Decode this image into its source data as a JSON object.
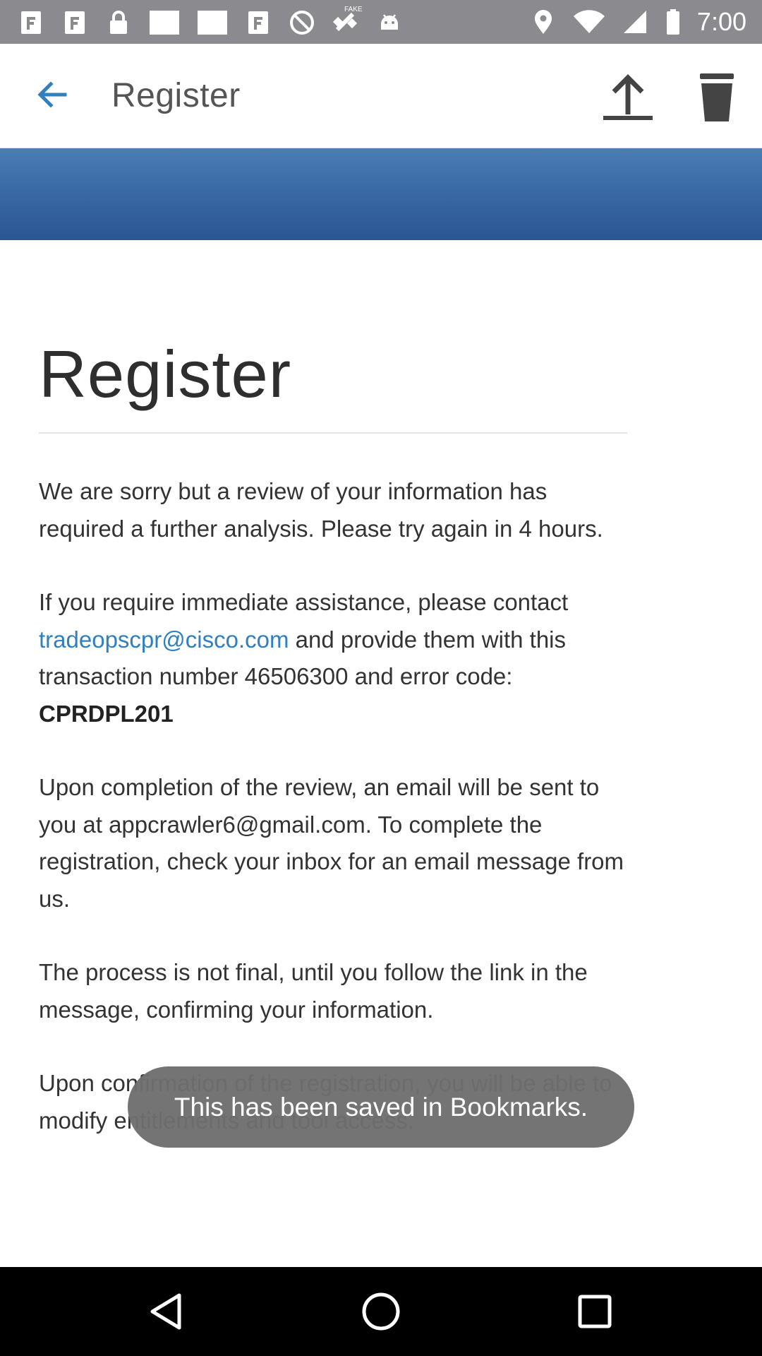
{
  "status_bar": {
    "time": "7:00",
    "fake_gps_label": "FAKE",
    "left_icons": [
      "f-icon",
      "f-icon",
      "lock-icon",
      "blank-notification-icon",
      "blank-notification-icon",
      "f-icon",
      "no-sim-icon",
      "satellite-icon",
      "android-icon"
    ],
    "right_icons": [
      "location-icon",
      "wifi-icon",
      "signal-icon",
      "battery-icon"
    ]
  },
  "app_bar": {
    "title": "Register",
    "back_icon": "arrow-back-icon",
    "upload_icon": "upload-icon",
    "delete_icon": "trash-icon",
    "accent_color": "#2f7fc1"
  },
  "banner": {
    "color": "#3a6aa6"
  },
  "content": {
    "heading": "Register",
    "p1": "We are sorry but a review of your information has required a further analysis. Please try again in 4 hours.",
    "p2_before": "If you require immediate assistance, please contact ",
    "p2_email": "tradeopscpr@cisco.com",
    "p2_middle": " and provide them with this transaction number 46506300 and error code: ",
    "p2_code": "CPRDPL201",
    "p3": "Upon completion of the review, an email will be sent to you at appcrawler6@gmail.com. To complete the registration, check your inbox for an email message from us.",
    "p4": "The process is not final, until you follow the link in the message, confirming your information.",
    "p5": "Upon confirmation of the registration, you will be able to modify entitlements and tool access."
  },
  "toast": {
    "message": "This has been saved in Bookmarks."
  },
  "nav_bar": {
    "icons": [
      "nav-back-icon",
      "nav-home-icon",
      "nav-recents-icon"
    ]
  }
}
